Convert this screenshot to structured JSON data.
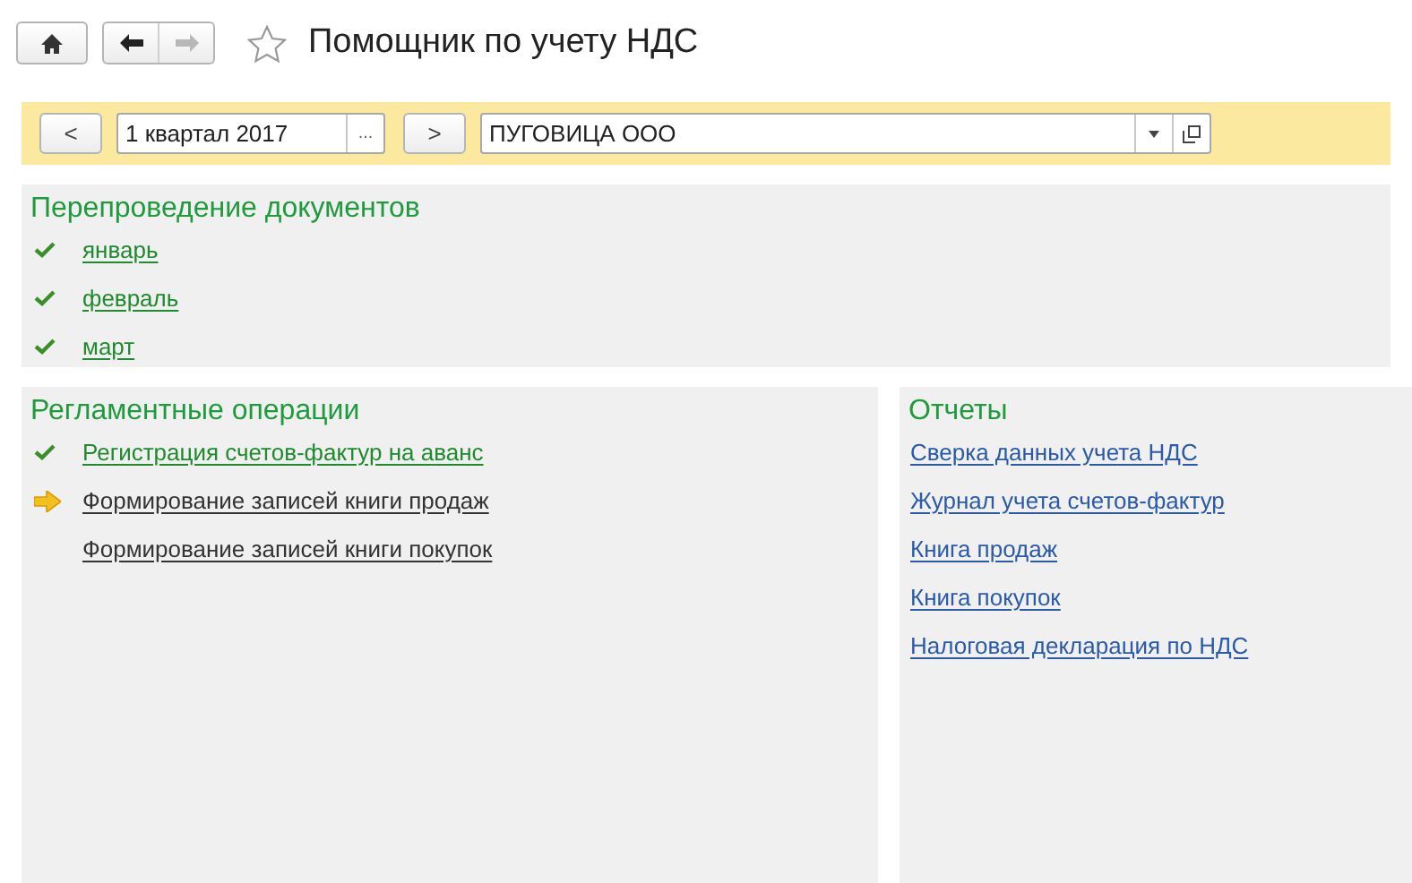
{
  "window": {
    "title": "Помощник по учету НДС",
    "favorite": false,
    "back_disabled": false,
    "forward_disabled": true
  },
  "toolbar": {
    "prev_label": "<",
    "period": "1 квартал 2017",
    "period_choose": "...",
    "next_label": ">",
    "organization": "ПУГОВИЦА ООО"
  },
  "reposting": {
    "title": "Перепроведение документов",
    "items": [
      {
        "label": "январь",
        "kind": "done"
      },
      {
        "label": "февраль",
        "kind": "done"
      },
      {
        "label": "март",
        "kind": "done"
      }
    ]
  },
  "operations": {
    "title": "Регламентные операции",
    "items": [
      {
        "label": "Регистрация счетов-фактур на аванс",
        "kind": "done"
      },
      {
        "label": "Формирование записей книги продаж",
        "kind": "current"
      },
      {
        "label": "Формирование записей книги покупок",
        "kind": "pending"
      }
    ]
  },
  "reports": {
    "title": "Отчеты",
    "items": [
      {
        "label": "Сверка данных учета НДС"
      },
      {
        "label": "Журнал учета счетов-фактур"
      },
      {
        "label": "Книга продаж"
      },
      {
        "label": "Книга покупок"
      },
      {
        "label": "Налоговая декларация по НДС"
      }
    ]
  }
}
